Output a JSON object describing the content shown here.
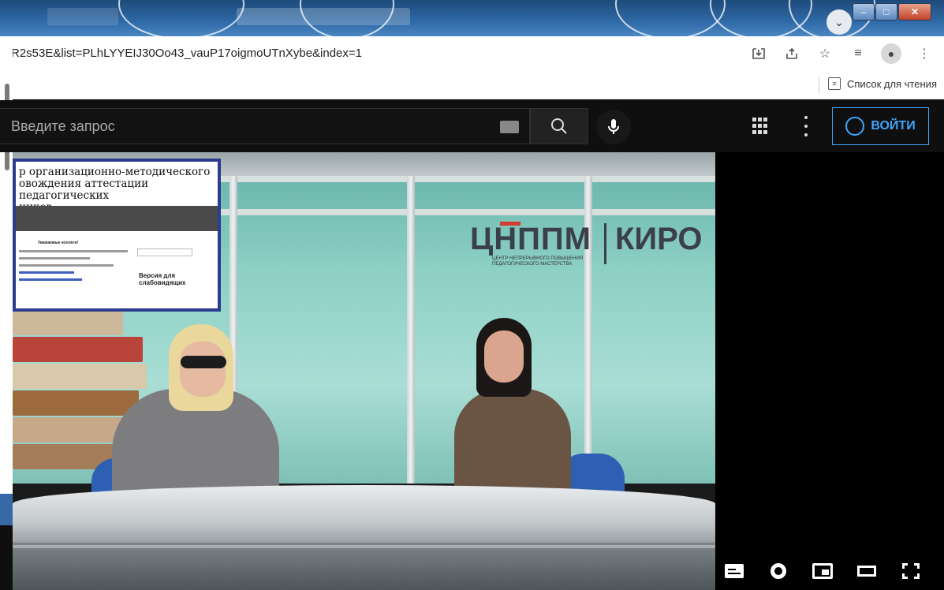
{
  "browser": {
    "url": "R2s53E&list=PLhLYYEIJ30Oo43_vauP17oigmoUTnXybe&index=1",
    "reading_list_label": "Список для чтения"
  },
  "youtube": {
    "search_placeholder": "Введите запрос",
    "signin_label": "ВОЙТИ"
  },
  "video": {
    "slide_title": "р организационно-методического\nовождения аттестации педагогических\nников",
    "slide_notice": "Уважаемые коллеги!",
    "slide_side_label": "Версия для\nслабовидящих",
    "logo_left": "ЦНППМ",
    "logo_right": "КИРО",
    "logo_subtitle": "ЦЕНТР НЕПРЕРЫВНОГО ПОВЫШЕНИЯ\nПЕДАГОГИЧЕСКОГО МАСТЕРСТВА",
    "progress": 0.0
  },
  "colors": {
    "yt_blue": "#3ea6ff",
    "yt_red": "#e52d27",
    "player_bg": "#0f0f0f"
  },
  "icons": {
    "addr": [
      "download-icon",
      "share-icon",
      "star-icon",
      "playlist-icon",
      "profile-icon",
      "kebab-icon"
    ],
    "controls": [
      "subtitles-icon",
      "settings-gear-icon",
      "miniplayer-icon",
      "theater-mode-icon",
      "fullscreen-icon"
    ]
  }
}
